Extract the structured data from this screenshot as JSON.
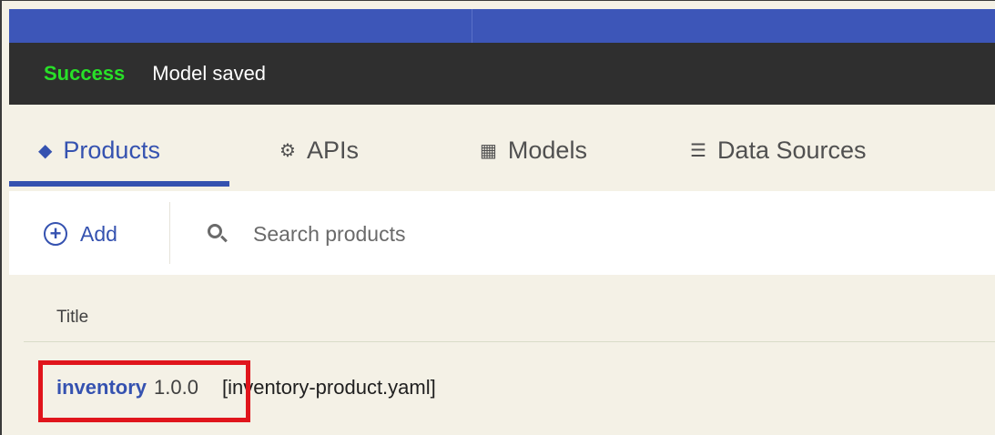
{
  "notification": {
    "status": "Success",
    "message": "Model saved"
  },
  "tabs": [
    {
      "label": "Products",
      "icon": "layers-icon",
      "active": true
    },
    {
      "label": "APIs",
      "icon": "cogs-icon",
      "active": false
    },
    {
      "label": "Models",
      "icon": "boxes-icon",
      "active": false
    },
    {
      "label": "Data Sources",
      "icon": "database-icon",
      "active": false
    }
  ],
  "toolbar": {
    "add_label": "Add",
    "search_placeholder": "Search products"
  },
  "table": {
    "columns": [
      "Title"
    ],
    "rows": [
      {
        "name": "inventory",
        "version": "1.0.0",
        "file": "[inventory-product.yaml]"
      }
    ]
  },
  "colors": {
    "accent": "#3552b0",
    "topbar": "#3d56b8",
    "notification_bg": "#2f2f2f",
    "success": "#28e028",
    "highlight": "#e0151c",
    "page_bg": "#f4f1e6"
  }
}
